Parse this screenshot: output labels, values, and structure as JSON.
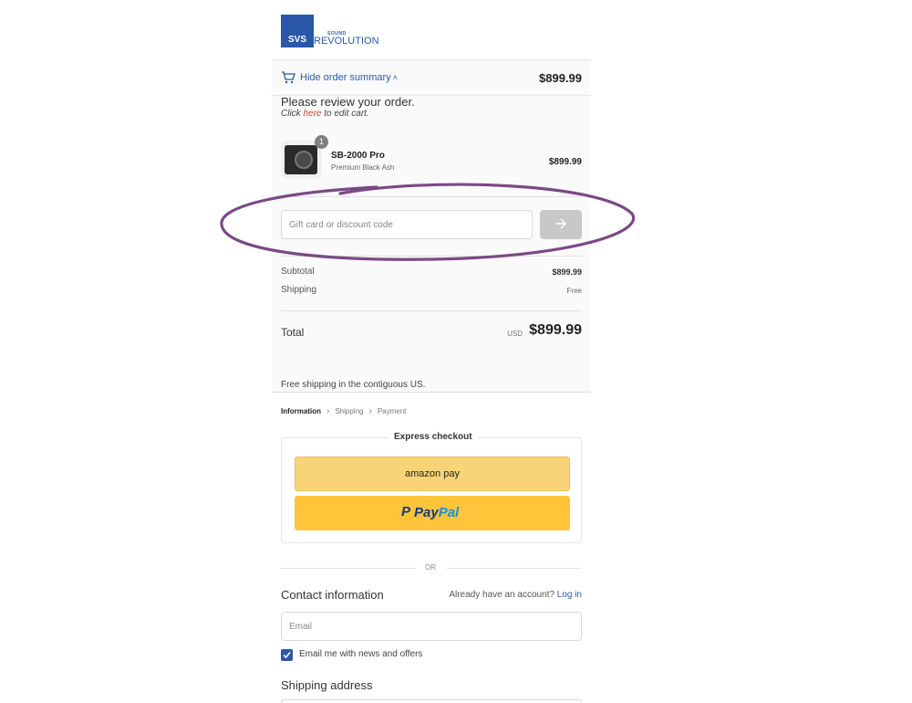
{
  "logo": {
    "mark": "SVS",
    "small": "SOUND",
    "text": "REVOLUTION"
  },
  "summary": {
    "toggle_label": "Hide order summary",
    "header_total": "$899.99",
    "review_title": "Please review your order.",
    "review_sub_prefix": "Click ",
    "review_sub_link": "here",
    "review_sub_suffix": " to edit cart.",
    "item": {
      "quantity": "1",
      "name": "SB-2000 Pro",
      "variant": "Premium Black Ash",
      "price": "$899.99"
    },
    "discount_placeholder": "Gift card or discount code",
    "apply_icon": "arrow-right-icon",
    "subtotal_label": "Subtotal",
    "subtotal_value": "$899.99",
    "shipping_label": "Shipping",
    "shipping_value": "Free",
    "total_label": "Total",
    "total_currency": "USD",
    "total_value": "$899.99",
    "free_shipping_note": "Free shipping in the contiguous US."
  },
  "breadcrumb": {
    "items": [
      "Information",
      "Shipping",
      "Payment"
    ]
  },
  "express": {
    "title": "Express checkout",
    "amazon_label": "amazon pay",
    "paypal_p": "P",
    "paypal_pay": "Pay",
    "paypal_pal": "Pal"
  },
  "or_text": "OR",
  "contact": {
    "title": "Contact information",
    "account_prompt": "Already have an account?",
    "login_link": "Log in",
    "email_placeholder": "Email",
    "newsletter_label": "Email me with news and offers",
    "newsletter_checked": true
  },
  "shipping": {
    "title": "Shipping address"
  },
  "colors": {
    "accent": "#2a5ba3",
    "annotation": "#7a4a84",
    "amazon": "#f9d476",
    "paypal": "#ffc43a"
  }
}
